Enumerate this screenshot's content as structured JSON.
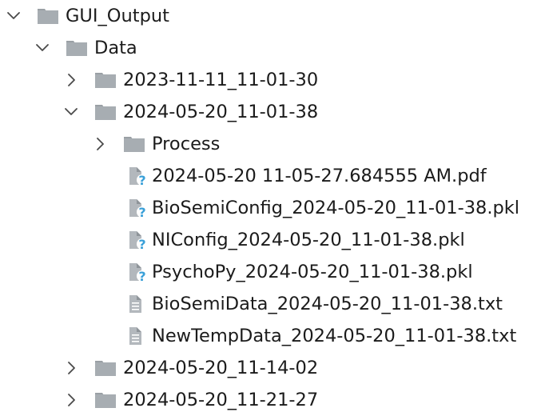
{
  "tree": {
    "rows": [
      {
        "label": "GUI_Output",
        "kind": "folder",
        "state": "expanded",
        "depth": 0
      },
      {
        "label": "Data",
        "kind": "folder",
        "state": "expanded",
        "depth": 1
      },
      {
        "label": "2023-11-11_11-01-30",
        "kind": "folder",
        "state": "collapsed",
        "depth": 2
      },
      {
        "label": "2024-05-20_11-01-38",
        "kind": "folder",
        "state": "expanded",
        "depth": 2
      },
      {
        "label": "Process",
        "kind": "folder",
        "state": "collapsed",
        "depth": 3
      },
      {
        "label": "2024-05-20 11-05-27.684555 AM.pdf",
        "kind": "file-unknown",
        "depth": 3
      },
      {
        "label": "BioSemiConfig_2024-05-20_11-01-38.pkl",
        "kind": "file-unknown",
        "depth": 3
      },
      {
        "label": "NIConfig_2024-05-20_11-01-38.pkl",
        "kind": "file-unknown",
        "depth": 3
      },
      {
        "label": "PsychoPy_2024-05-20_11-01-38.pkl",
        "kind": "file-unknown",
        "depth": 3
      },
      {
        "label": "BioSemiData_2024-05-20_11-01-38.txt",
        "kind": "file-text",
        "depth": 3
      },
      {
        "label": "NewTempData_2024-05-20_11-01-38.txt",
        "kind": "file-text",
        "depth": 3
      },
      {
        "label": "2024-05-20_11-14-02",
        "kind": "folder",
        "state": "collapsed",
        "depth": 2
      },
      {
        "label": "2024-05-20_11-21-27",
        "kind": "folder",
        "state": "collapsed",
        "depth": 2
      }
    ]
  },
  "colors": {
    "folder": "#a7adb2",
    "folder_tab": "#9aa0a5",
    "file": "#b3b8bd",
    "file_fold": "#8e9499",
    "question": "#3aa0d8",
    "chevron": "#4a4a4a",
    "text": "#1b1b1b"
  },
  "icons": {
    "expanded": "chevron-down-icon",
    "collapsed": "chevron-right-icon",
    "folder": "folder-icon",
    "file-unknown": "unknown-file-icon",
    "file-text": "text-file-icon"
  }
}
